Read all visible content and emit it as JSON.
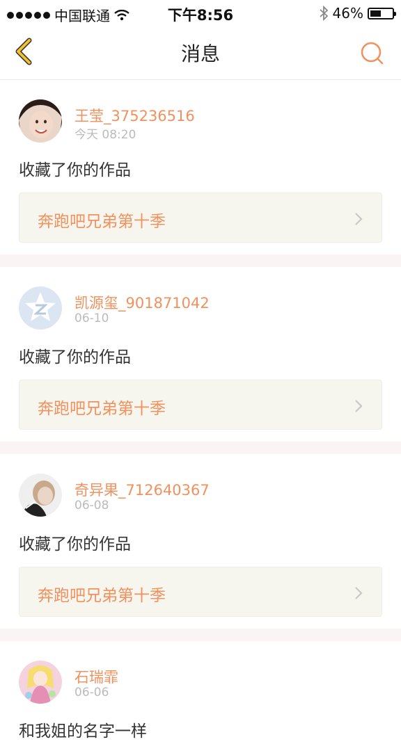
{
  "status_bar": {
    "carrier": "中国联通",
    "time": "下午8:56",
    "battery": "46%",
    "battery_level": 0.46
  },
  "nav": {
    "title": "消息",
    "back_icon": "chevron-left-icon",
    "search_icon": "search-icon"
  },
  "colors": {
    "accent": "#f0915e",
    "back_icon": "#f1c033",
    "link_box_bg": "#f6f6ef",
    "separator": "#fbf4f4"
  },
  "messages": [
    {
      "name": "王莹_375236516",
      "time": "今天 08:20",
      "action": "收藏了你的作品",
      "link": "奔跑吧兄弟第十季"
    },
    {
      "name": "凯源玺_901871042",
      "time": "06-10",
      "action": "收藏了你的作品",
      "link": "奔跑吧兄弟第十季"
    },
    {
      "name": "奇异果_712640367",
      "time": "06-08",
      "action": "收藏了你的作品",
      "link": "奔跑吧兄弟第十季"
    },
    {
      "name": "石瑞霏",
      "time": "06-06",
      "action": "和我姐的名字一样"
    }
  ]
}
